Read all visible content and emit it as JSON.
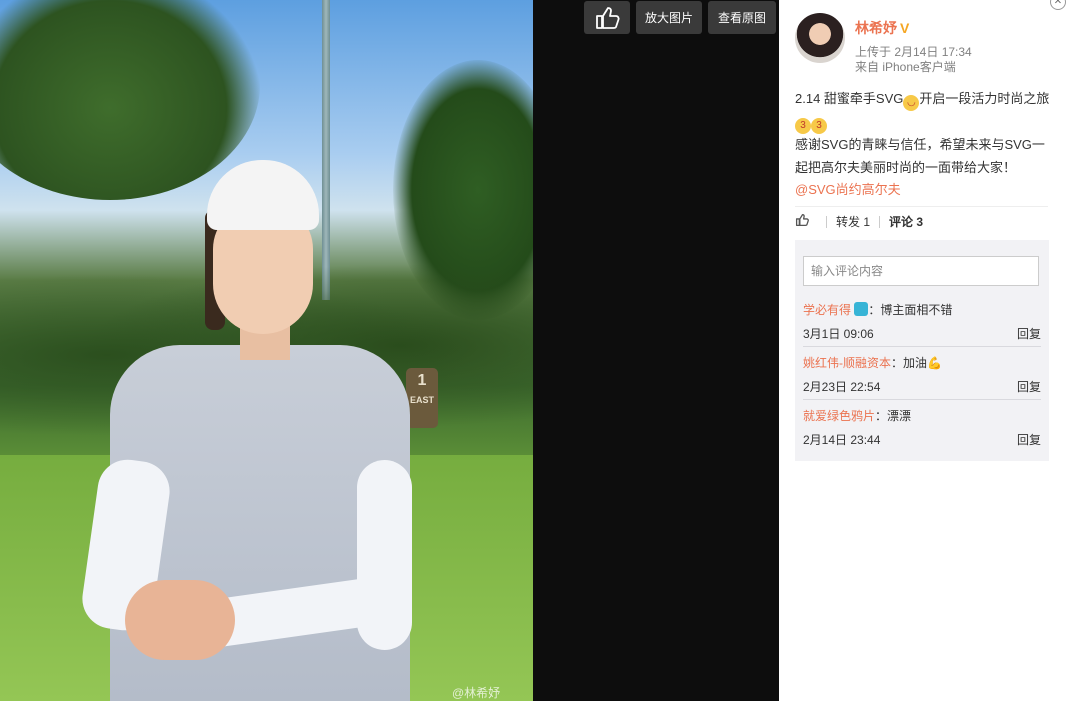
{
  "toolbar": {
    "like_icon": "thumbs-up-icon",
    "zoom_label": "放大图片",
    "original_label": "查看原图"
  },
  "photo": {
    "watermark": "@林希妤",
    "post_marker_number": "1",
    "post_marker_text": "EAST"
  },
  "author": {
    "name": "林希妤",
    "verified": "V",
    "upload_time": "上传于 2月14日 17:34",
    "source": "来自 iPhone客户端"
  },
  "post": {
    "line1_a": "2.14 甜蜜牵手SVG",
    "line1_b": "开启一段活力时尚之旅",
    "line2": "感谢SVG的青睐与信任，希望未来与SVG一起把高尔夫美丽时尚的一面带给大家！",
    "mention": "@SVG尚约高尔夫"
  },
  "actions": {
    "repost": "转发 1",
    "comment": "评论 3"
  },
  "comment_box": {
    "placeholder": "输入评论内容"
  },
  "comments": [
    {
      "user": "学必有得",
      "text": "：博主面相不错",
      "time": "3月1日 09:06",
      "reply": "回复"
    },
    {
      "user": "姚红伟-顺融资本",
      "text": "：加油💪",
      "time": "2月23日 22:54",
      "reply": "回复"
    },
    {
      "user": "就爱绿色鸦片",
      "text": "：漂漂",
      "time": "2月14日 23:44",
      "reply": "回复"
    }
  ],
  "colors": {
    "accent": "#eb7350",
    "verified": "#f5a623",
    "viewer_bg": "#0d0d0d"
  }
}
